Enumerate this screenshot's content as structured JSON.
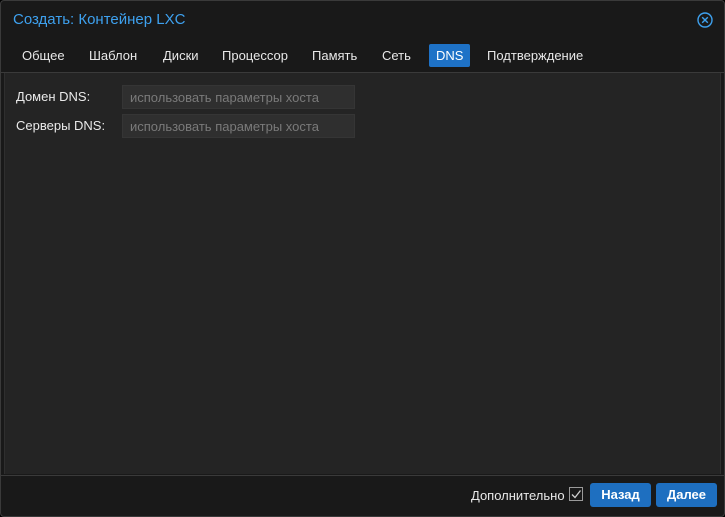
{
  "window": {
    "title": "Создать: Контейнер LXC"
  },
  "tabs": [
    {
      "label": "Общее",
      "active": false
    },
    {
      "label": "Шаблон",
      "active": false
    },
    {
      "label": "Диски",
      "active": false
    },
    {
      "label": "Процессор",
      "active": false
    },
    {
      "label": "Память",
      "active": false
    },
    {
      "label": "Сеть",
      "active": false
    },
    {
      "label": "DNS",
      "active": true
    },
    {
      "label": "Подтверждение",
      "active": false
    }
  ],
  "form": {
    "dns_domain": {
      "label": "Домен DNS:",
      "value": "",
      "placeholder": "использовать параметры хоста"
    },
    "dns_servers": {
      "label": "Серверы DNS:",
      "value": "",
      "placeholder": "использовать параметры хоста"
    }
  },
  "footer": {
    "advanced_label": "Дополнительно",
    "advanced_checked": true,
    "back_label": "Назад",
    "next_label": "Далее"
  },
  "colors": {
    "accent": "#1e72c7",
    "title": "#3ea1ef",
    "background": "#191919",
    "panel": "#242424"
  },
  "icons": {
    "close": "close-circle-icon",
    "checkbox": "checkbox-checked-icon"
  }
}
